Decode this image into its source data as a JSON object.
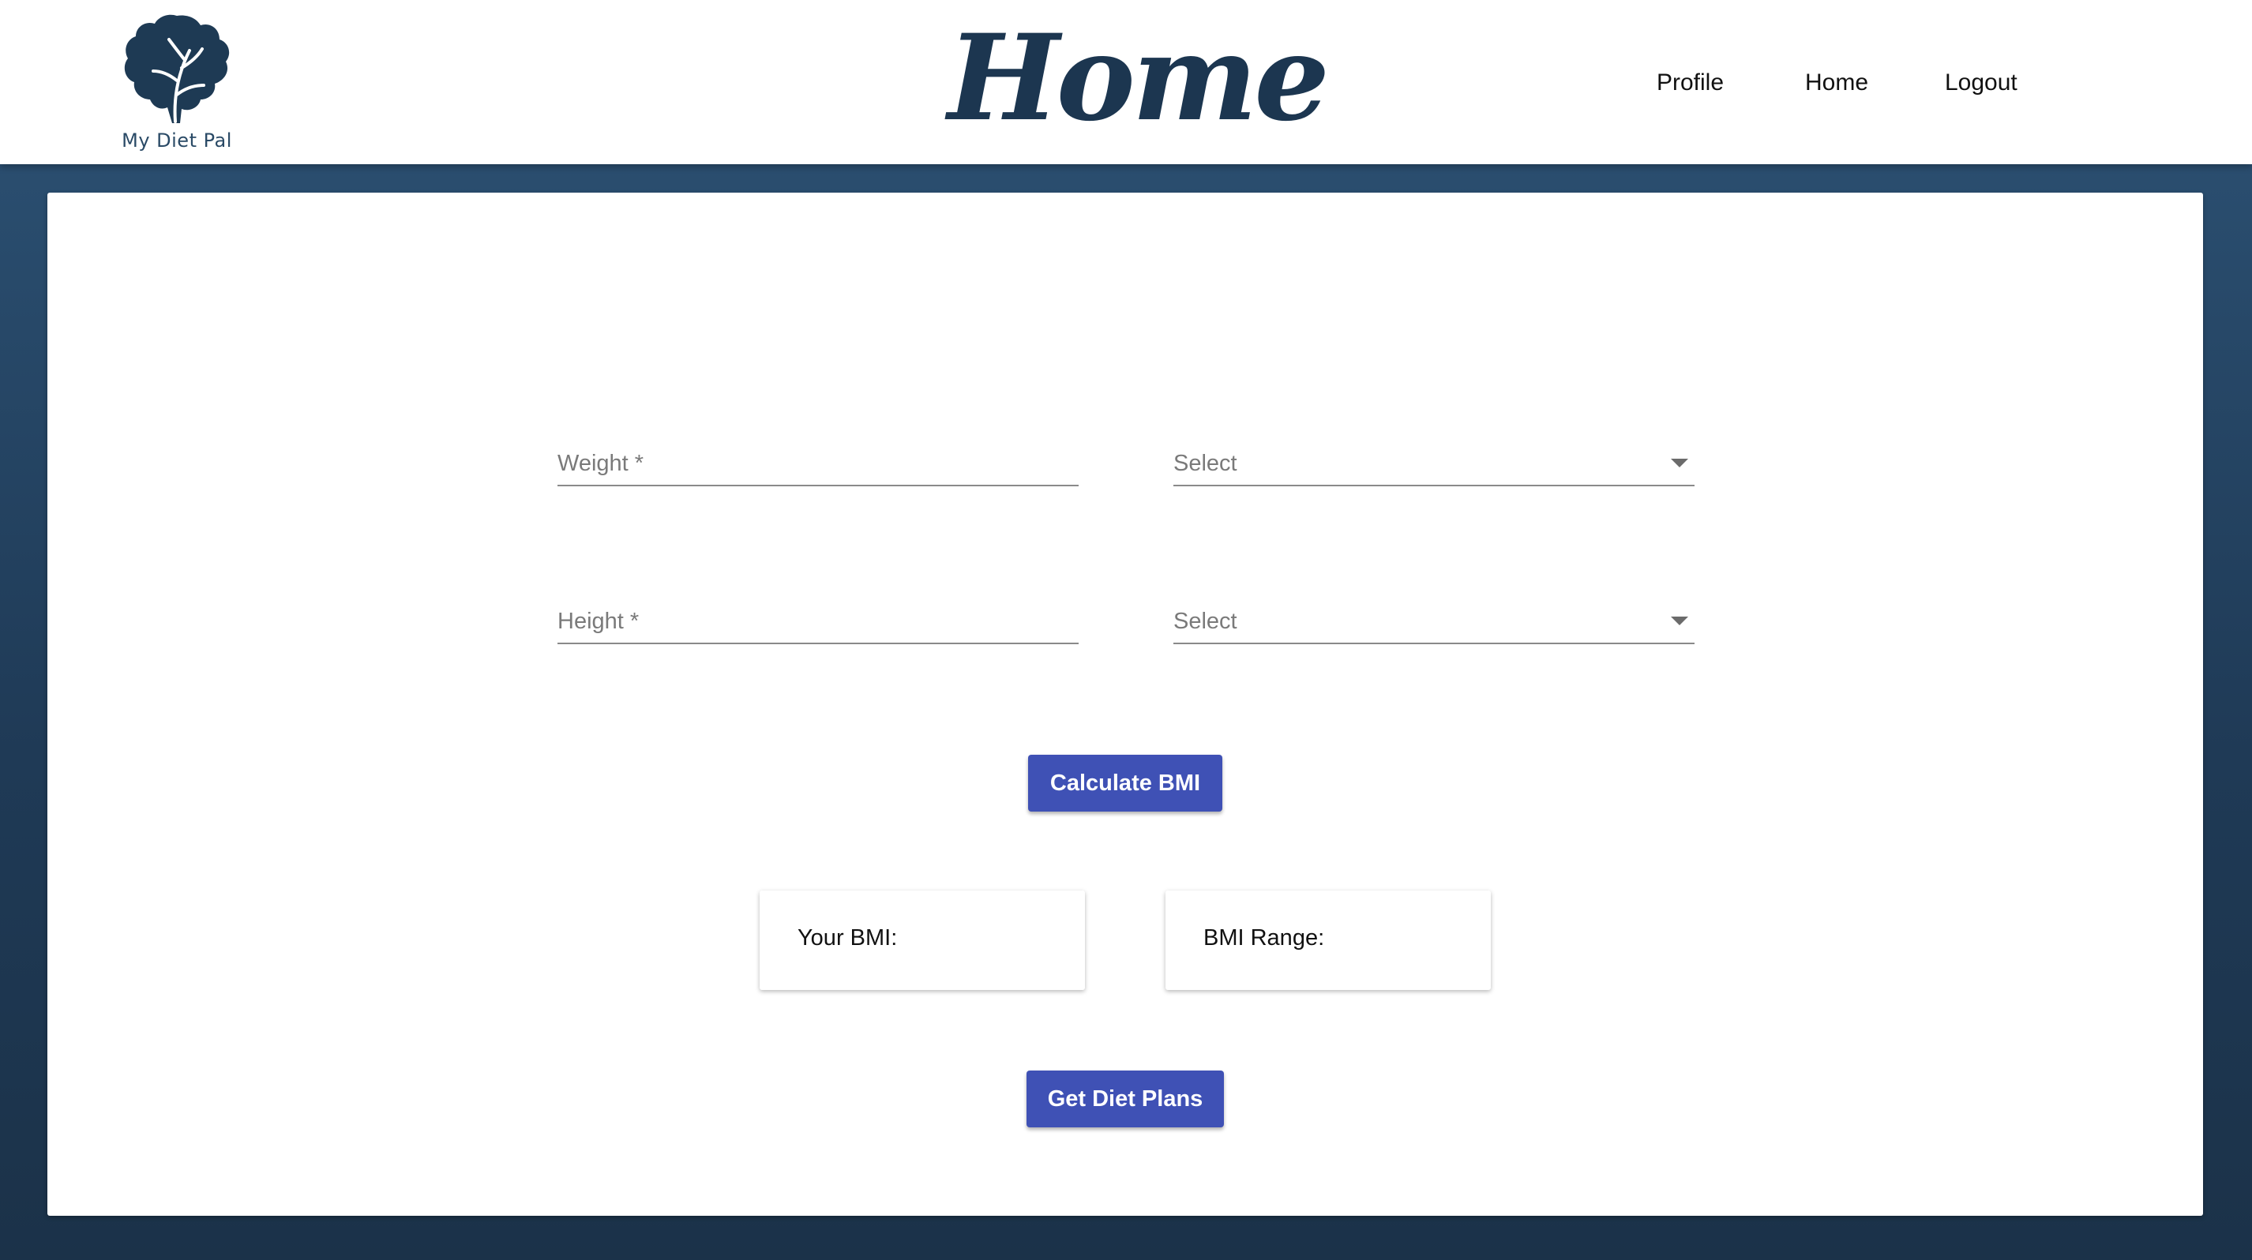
{
  "header": {
    "logo_text": "My Diet Pal",
    "title": "Home",
    "nav": {
      "profile": "Profile",
      "home": "Home",
      "logout": "Logout"
    }
  },
  "form": {
    "weight": {
      "label": "Weight *",
      "value": ""
    },
    "weight_unit": {
      "label": "Select",
      "value": ""
    },
    "height": {
      "label": "Height *",
      "value": ""
    },
    "height_unit": {
      "label": "Select",
      "value": ""
    },
    "calculate_label": "Calculate BMI"
  },
  "results": {
    "bmi_label": "Your BMI:",
    "range_label": "BMI Range:"
  },
  "diet_plans_label": "Get Diet Plans",
  "colors": {
    "primary": "#3f51b5",
    "brand_dark": "#1c3650",
    "background_top": "#2d5376",
    "background_bottom": "#1b3249"
  },
  "icons": {
    "logo": "lettuce-leaf-icon",
    "dropdown": "caret-down-icon"
  }
}
